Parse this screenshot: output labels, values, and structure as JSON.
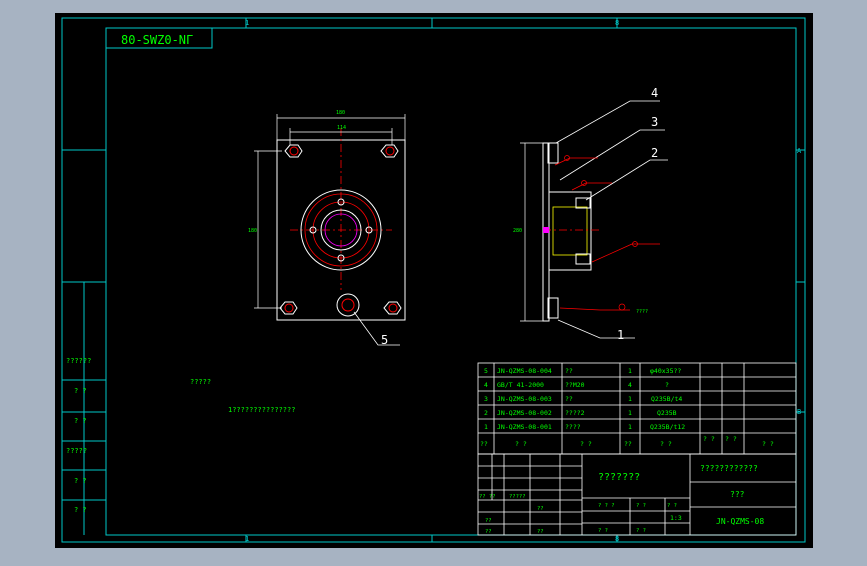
{
  "drawing": {
    "title_block_code": "80-SWZ0-NГ",
    "zone_top_left": "1",
    "zone_top_mid": "8",
    "zone_right_a": "A",
    "zone_right_b": "B",
    "zone_bottom_left": "1",
    "zone_bottom_mid": "8",
    "notes": {
      "heading": "?????",
      "line1": "1???????????????"
    },
    "callouts": [
      "1",
      "2",
      "3",
      "4",
      "5"
    ],
    "dims": {
      "top_outer": "180",
      "top_inner": "114",
      "left": "180",
      "side": "280"
    },
    "weld_note": "????",
    "left_strip": [
      "??????",
      "? ?",
      "? ?",
      "?????",
      "? ?",
      "? ?"
    ]
  },
  "bom": {
    "rows": [
      {
        "no": "5",
        "code": "JN-QZMS-08-004",
        "name": "??",
        "qty": "1",
        "material": "φ40x35??"
      },
      {
        "no": "4",
        "code": "GB/T 41-2000",
        "name": "??M20",
        "qty": "4",
        "material": "?"
      },
      {
        "no": "3",
        "code": "JN-QZMS-08-003",
        "name": "??",
        "qty": "1",
        "material": "Q235B/t4"
      },
      {
        "no": "2",
        "code": "JN-QZMS-08-002",
        "name": "????2",
        "qty": "1",
        "material": "Q235B"
      },
      {
        "no": "1",
        "code": "JN-QZMS-08-001",
        "name": "????",
        "qty": "1",
        "material": "Q235B/t12"
      }
    ],
    "header": {
      "no": "??",
      "code": "? ?",
      "name": "? ?",
      "qty": "??",
      "material": "? ?",
      "w1": "? ?",
      "w2": "? ?",
      "remark": "? ?"
    }
  },
  "title_block": {
    "drawing_name": "???????",
    "company": "????????????",
    "unit": "???",
    "drawing_no": "JN-QZMS-08",
    "scale": "1:3",
    "left_labels": [
      "?? ??",
      "?????",
      "??",
      "??",
      "??",
      "??"
    ],
    "mid_labels": [
      "? ? ?",
      "? ?",
      "? ?",
      "? ?",
      "? ?"
    ]
  },
  "colors": {
    "frame": "#00c8c8",
    "line": "#ffffff",
    "text": "#00ff00",
    "accent": "#ff0000",
    "magenta": "#ff00ff",
    "yellow": "#ffff00"
  }
}
